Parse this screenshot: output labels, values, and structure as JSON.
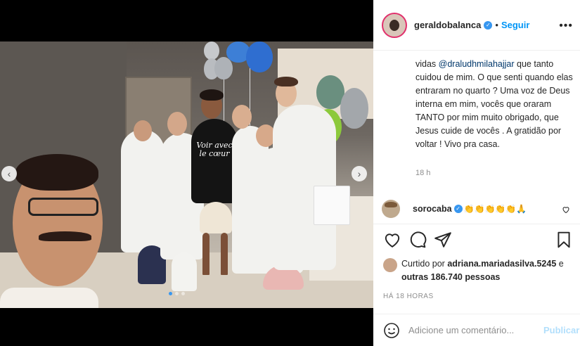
{
  "post": {
    "username": "geraldobalanca",
    "separator": "•",
    "follow_label": "Seguir",
    "more_label": "•••",
    "caption": {
      "part1": "vidas ",
      "mention": "@draludhmilahajjar",
      "part2": " que tanto cuidou de mim. O que senti quando elas entraram no quarto ? Uma voz de Deus interna em mim, vocês que oraram TANTO por mim muito obrigado, que Jesus cuide de vocês . A gratidão por voltar ! Vivo pra casa."
    },
    "caption_age": "18 h",
    "comment": {
      "username": "sorocaba",
      "text": "👏👏👏👏👏🙏"
    },
    "likes": {
      "prefix": "Curtido por ",
      "user": "adriana.mariadasilva.5245",
      "middle": " e ",
      "others": "outras 186.740 pessoas"
    },
    "timestamp": "HÁ 18 HORAS",
    "comment_input_placeholder": "Adicione um comentário...",
    "publish_label": "Publicar"
  },
  "photo": {
    "shirt_text": "Voir avec le cœur"
  },
  "colors": {
    "accent": "#0095f6",
    "verified": "#3897f0",
    "publish_disabled": "#b2dffc",
    "muted": "#8e8e8e"
  },
  "icons": [
    "verified-icon",
    "heart-icon",
    "comment-icon",
    "share-icon",
    "bookmark-icon",
    "emoji-icon",
    "chevron-left-icon",
    "chevron-right-icon"
  ]
}
